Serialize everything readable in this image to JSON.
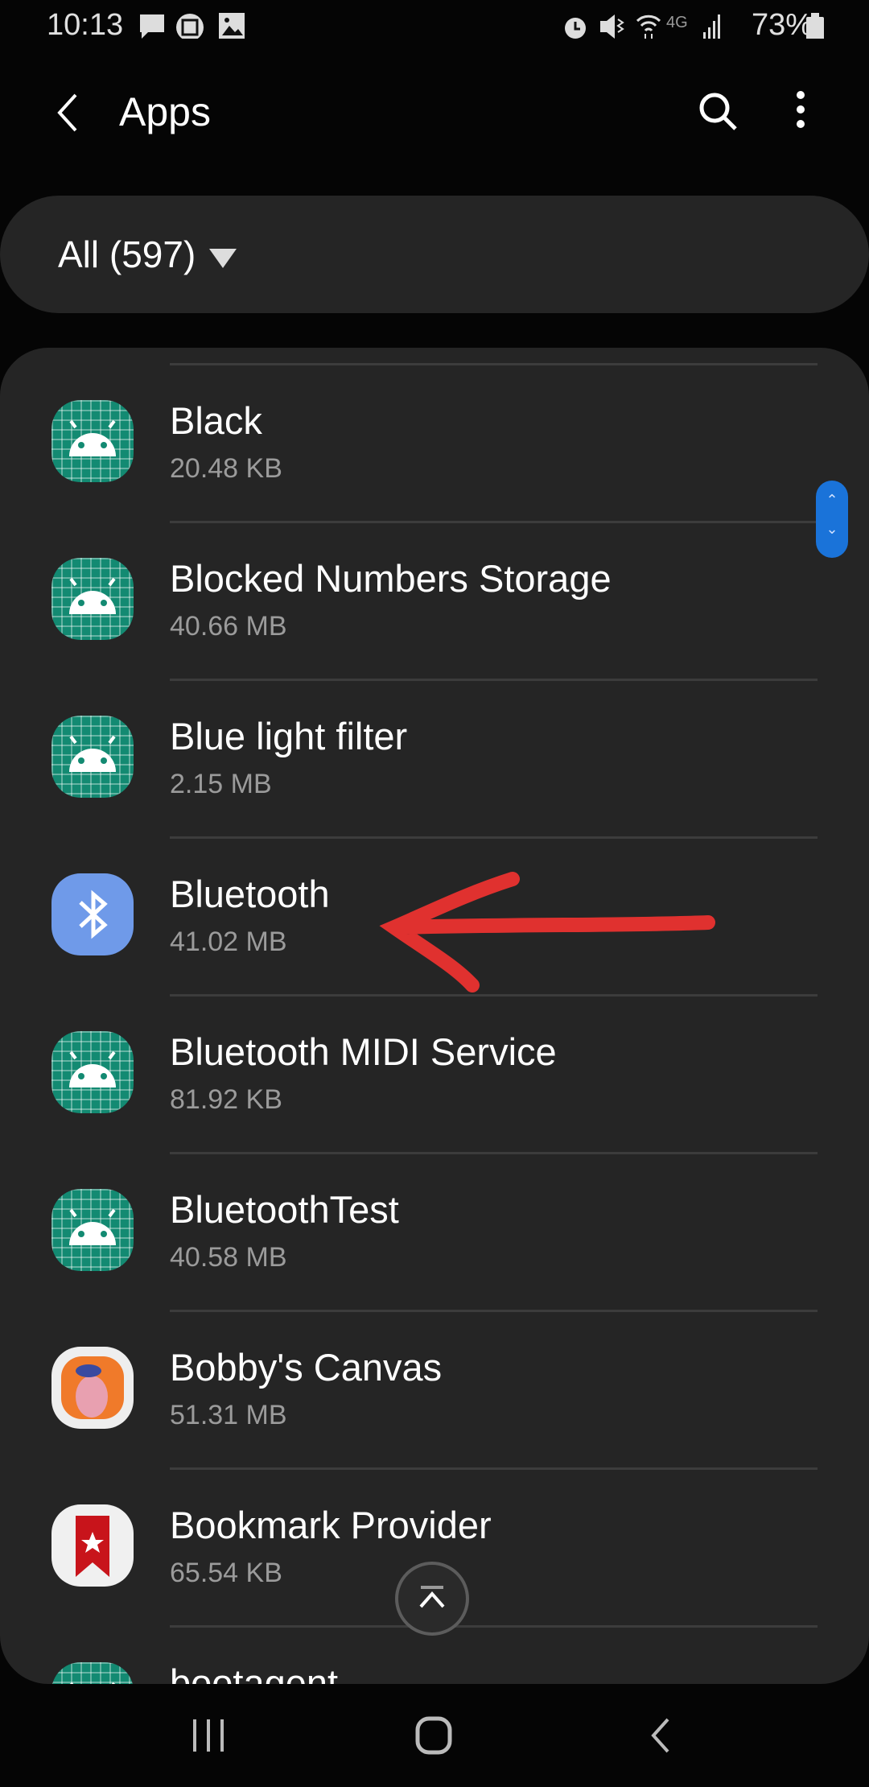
{
  "status_bar": {
    "time": "10:13",
    "battery": "73%",
    "icons_left": [
      "message-icon",
      "screen-icon",
      "image-icon"
    ],
    "icons_right": [
      "alarm-icon",
      "mute-icon",
      "wifi-icon",
      "4g-icon",
      "signal-icon",
      "battery-icon"
    ]
  },
  "header": {
    "title": "Apps",
    "back_icon": "chevron-left-icon",
    "search_icon": "search-icon",
    "more_icon": "more-vertical-icon"
  },
  "filter": {
    "label": "All (597)"
  },
  "apps": [
    {
      "name": "Black",
      "size": "20.48 KB",
      "icon": "android"
    },
    {
      "name": "Blocked Numbers Storage",
      "size": "40.66 MB",
      "icon": "android"
    },
    {
      "name": "Blue light filter",
      "size": "2.15 MB",
      "icon": "android"
    },
    {
      "name": "Bluetooth",
      "size": "41.02 MB",
      "icon": "bluetooth"
    },
    {
      "name": "Bluetooth MIDI Service",
      "size": "81.92 KB",
      "icon": "android"
    },
    {
      "name": "BluetoothTest",
      "size": "40.58 MB",
      "icon": "android"
    },
    {
      "name": "Bobby's Canvas",
      "size": "51.31 MB",
      "icon": "bobby"
    },
    {
      "name": "Bookmark Provider",
      "size": "65.54 KB",
      "icon": "bookmark"
    },
    {
      "name": "bootagent",
      "size": "",
      "icon": "android"
    }
  ],
  "annotation": {
    "color": "#e0312f",
    "points_to": "Bluetooth"
  },
  "colors": {
    "scrollbar": "#1a73d9",
    "android_icon": "#138a72",
    "bluetooth_icon": "#6f9ae9"
  }
}
